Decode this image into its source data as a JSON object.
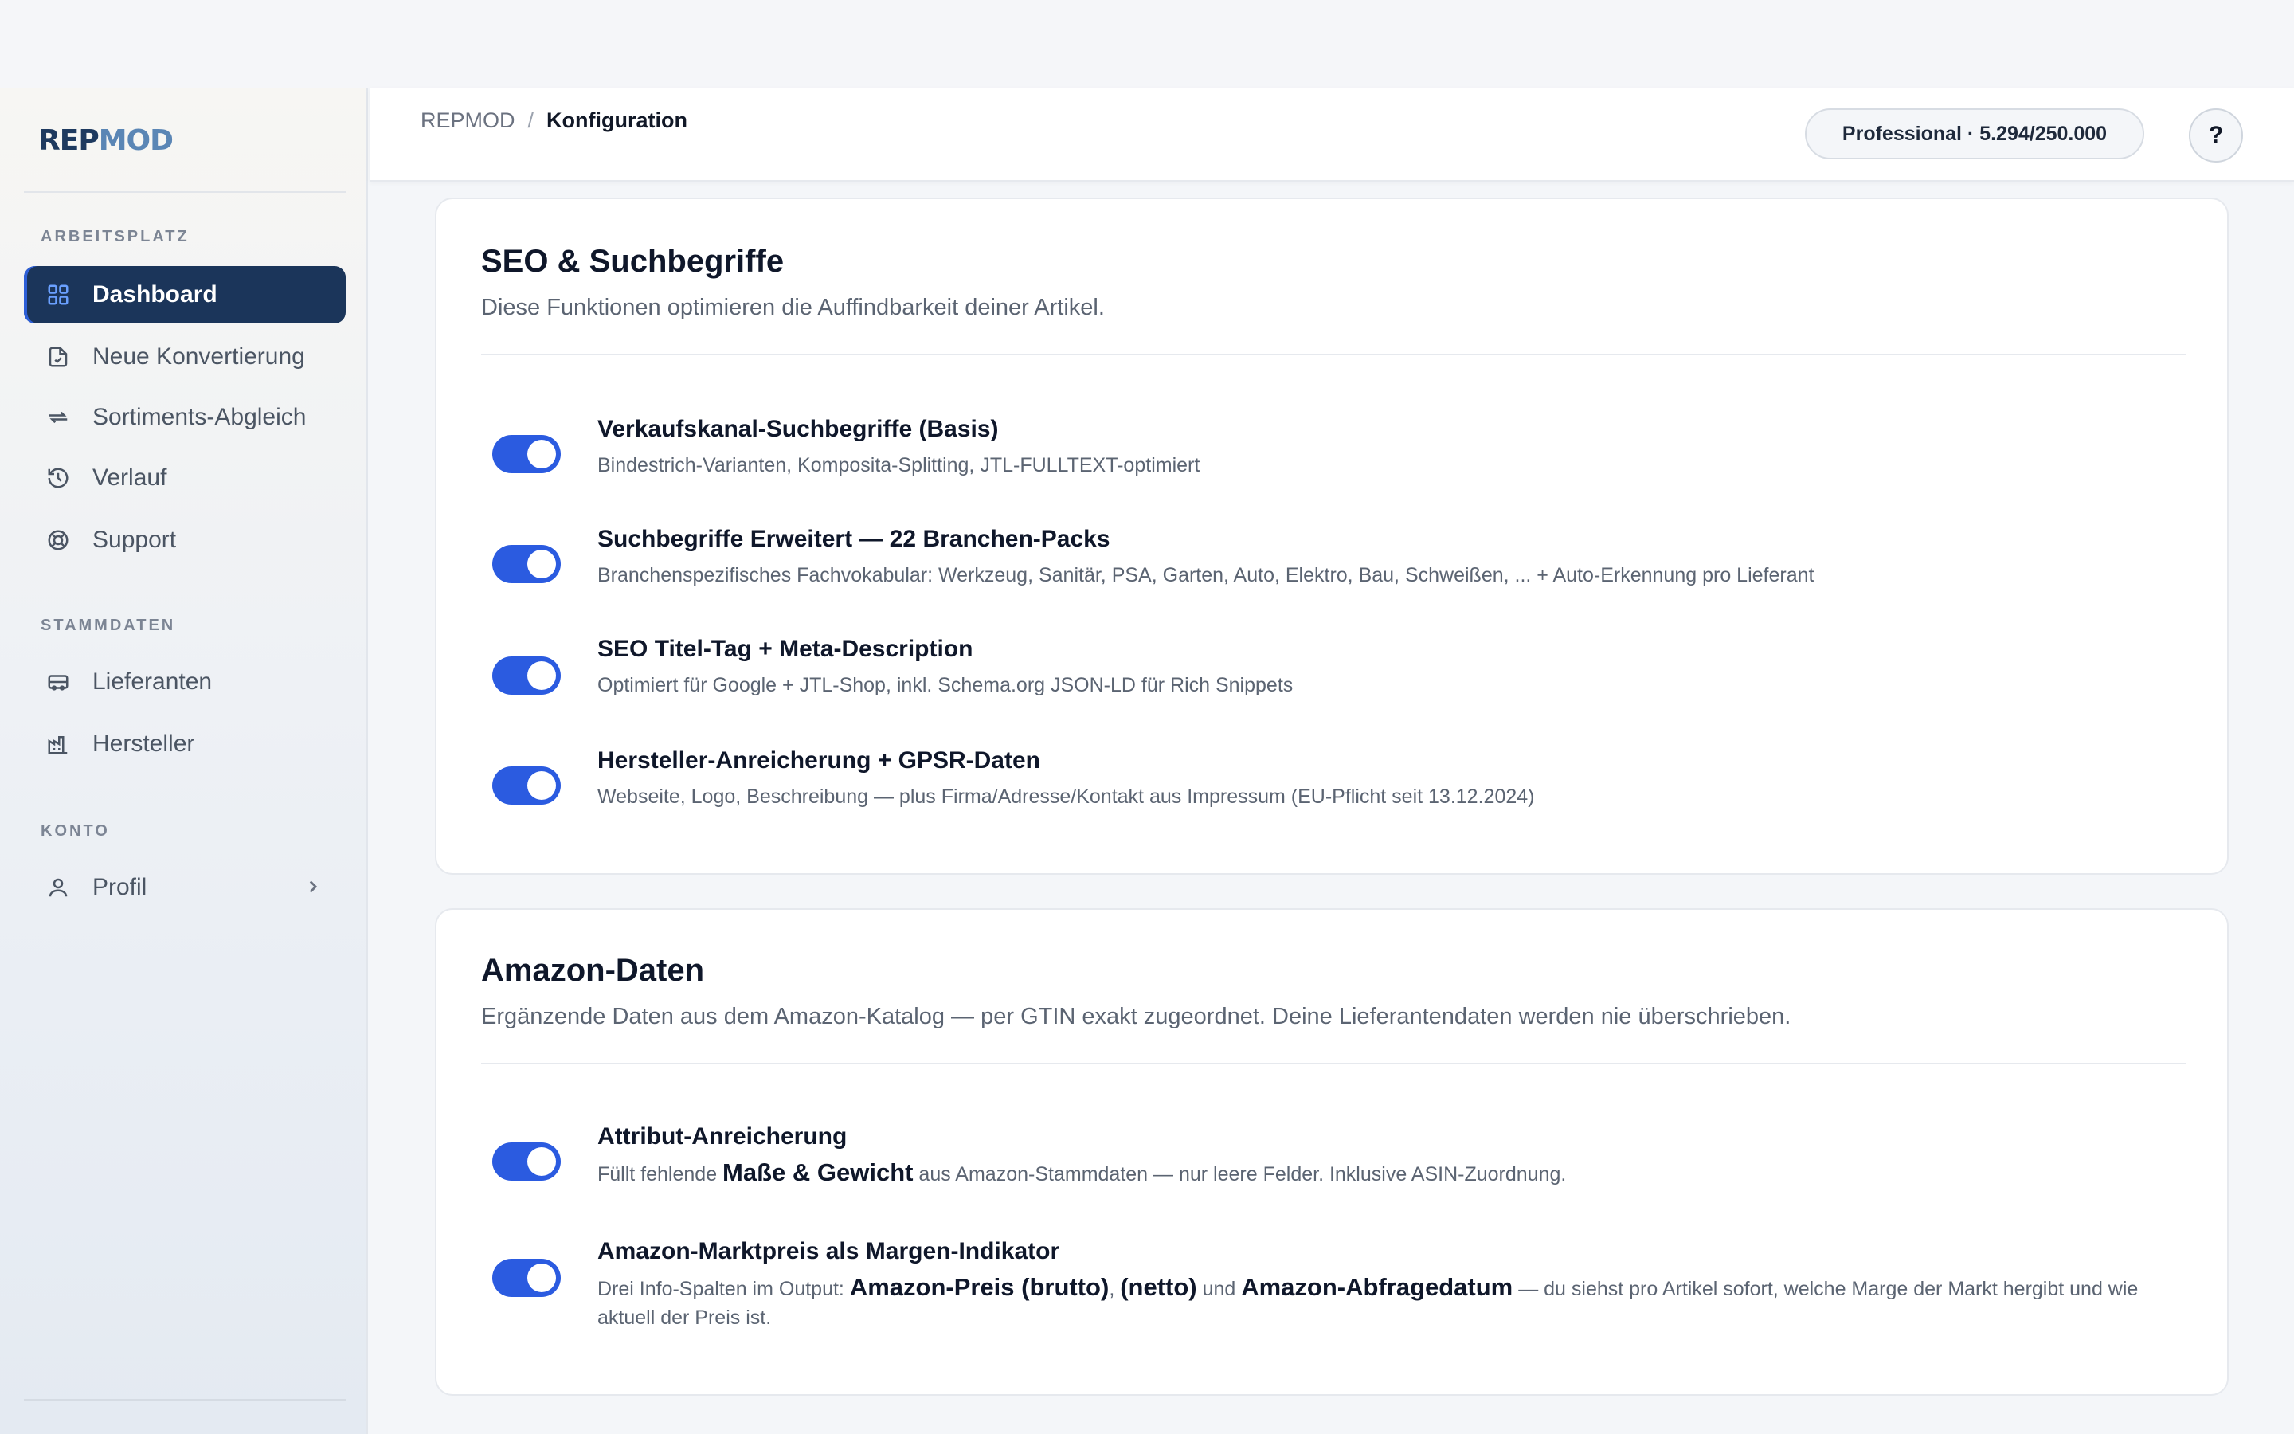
{
  "brand": {
    "part1": "REP",
    "part2": "MOD"
  },
  "sidebar": {
    "sections": [
      {
        "label": "ARBEITSPLATZ"
      },
      {
        "label": "STAMMDATEN"
      },
      {
        "label": "KONTO"
      }
    ],
    "items": [
      {
        "label": "Dashboard",
        "icon": "grid-icon",
        "active": true
      },
      {
        "label": "Neue Konvertierung",
        "icon": "file-convert-icon"
      },
      {
        "label": "Sortiments-Abgleich",
        "icon": "arrows-left-right-icon"
      },
      {
        "label": "Verlauf",
        "icon": "history-icon"
      },
      {
        "label": "Support",
        "icon": "lifebuoy-icon"
      },
      {
        "label": "Lieferanten",
        "icon": "truck-icon"
      },
      {
        "label": "Hersteller",
        "icon": "factory-icon"
      },
      {
        "label": "Profil",
        "icon": "user-icon"
      }
    ]
  },
  "header": {
    "breadcrumb_root": "REPMOD",
    "breadcrumb_sep": "/",
    "breadcrumb_current": "Konfiguration",
    "plan_badge": "Professional · 5.294/250.000",
    "help_label": "?"
  },
  "cards": [
    {
      "title": "SEO & Suchbegriffe",
      "subtitle": "Diese Funktionen optimieren die Auffindbarkeit deiner Artikel.",
      "options": [
        {
          "title": "Verkaufskanal-Suchbegriffe (Basis)",
          "desc": "Bindestrich-Varianten, Komposita-Splitting, JTL-FULLTEXT-optimiert",
          "enabled": true
        },
        {
          "title": "Suchbegriffe Erweitert — 22 Branchen-Packs",
          "desc": "Branchenspezifisches Fachvokabular: Werkzeug, Sanitär, PSA, Garten, Auto, Elektro, Bau, Schweißen, ... + Auto-Erkennung pro Lieferant",
          "enabled": true
        },
        {
          "title": "SEO Titel-Tag + Meta-Description",
          "desc": "Optimiert für Google + JTL-Shop, inkl. Schema.org JSON-LD für Rich Snippets",
          "enabled": true
        },
        {
          "title": "Hersteller-Anreicherung + GPSR-Daten",
          "desc": "Webseite, Logo, Beschreibung — plus Firma/Adresse/Kontakt aus Impressum (EU-Pflicht seit 13.12.2024)",
          "enabled": true
        }
      ]
    },
    {
      "title": "Amazon-Daten",
      "subtitle": "Ergänzende Daten aus dem Amazon-Katalog — per GTIN exakt zugeordnet. Deine Lieferantendaten werden nie überschrieben.",
      "options": [
        {
          "title": "Attribut-Anreicherung",
          "desc_parts": [
            "Füllt fehlende ",
            "Maße & Gewicht",
            " aus Amazon-Stammdaten — nur leere Felder. Inklusive ASIN-Zuordnung."
          ],
          "enabled": true
        },
        {
          "title": "Amazon-Marktpreis als Margen-Indikator",
          "desc_parts": [
            "Drei Info-Spalten im Output: ",
            "Amazon-Preis (brutto)",
            ", ",
            "(netto)",
            " und ",
            "Amazon-Abfragedatum",
            " — du siehst pro Artikel sofort, welche Marge der Markt hergibt und wie aktuell der Preis ist."
          ],
          "enabled": true
        }
      ]
    }
  ],
  "colors": {
    "accent": "#2b5be0",
    "nav_active": "#1b355a",
    "brand_dark": "#1e3a5f",
    "brand_light": "#5a86b5"
  }
}
